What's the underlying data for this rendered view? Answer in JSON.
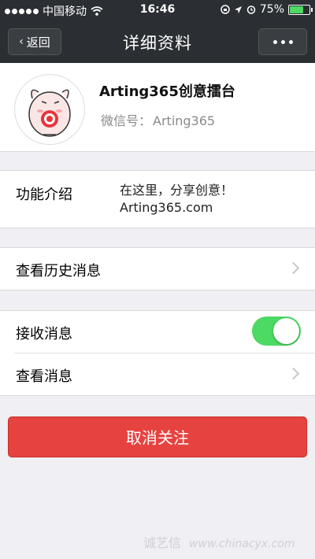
{
  "status_bar": {
    "carrier": "中国移动",
    "time": "16:46",
    "battery_percent": "75%",
    "battery_level": 0.75,
    "signal_icon": "signal-dots-icon",
    "wifi_icon": "wifi-icon"
  },
  "nav": {
    "back_label": "返回",
    "title": "详细资料",
    "more_icon": "more-dots-icon"
  },
  "profile": {
    "name": "Arting365创意擂台",
    "wechat_label": "微信号：",
    "wechat_id": "Arting365"
  },
  "intro": {
    "label": "功能介绍",
    "line1": "在这里，分享创意！",
    "line2": "Arting365.com"
  },
  "history": {
    "label": "查看历史消息"
  },
  "messages": {
    "receive_label": "接收消息",
    "receive_on": true,
    "view_label": "查看消息"
  },
  "unfollow_label": "取消关注",
  "watermark": {
    "text": "诚艺信",
    "url": "www.chinacyx.com"
  },
  "colors": {
    "nav_bg": "#2b2f33",
    "toggle_on": "#4cd964",
    "danger": "#e64340",
    "page_bg": "#efeff4"
  }
}
